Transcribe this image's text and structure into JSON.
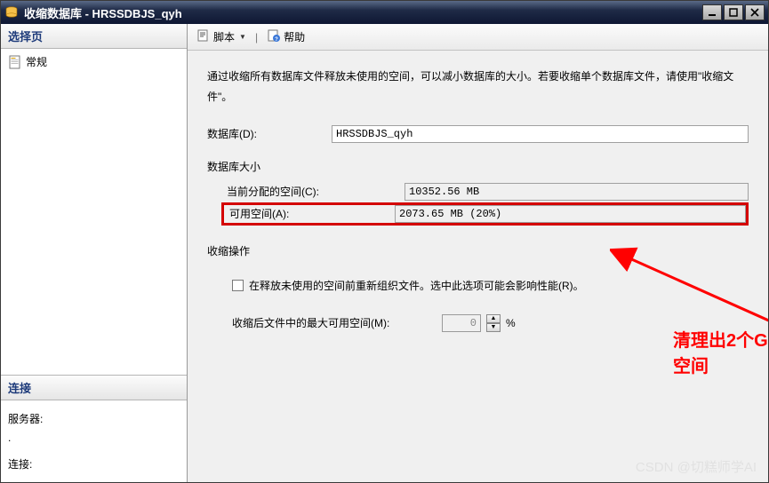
{
  "window": {
    "title": "收缩数据库 - HRSSDBJS_qyh"
  },
  "left": {
    "select_header": "选择页",
    "tree_item": "常规",
    "connection_header": "连接",
    "server_label": "服务器:",
    "connection_label": "连接:"
  },
  "toolbar": {
    "script": "脚本",
    "help": "帮助"
  },
  "content": {
    "intro": "通过收缩所有数据库文件释放未使用的空间，可以减小数据库的大小。若要收缩单个数据库文件，请使用\"收缩文件\"。",
    "db_label": "数据库(D):",
    "db_value": "HRSSDBJS_qyh",
    "size_section": "数据库大小",
    "allocated_label": "当前分配的空间(C):",
    "allocated_value": "10352.56 MB",
    "free_label": "可用空间(A):",
    "free_value": "2073.65 MB (20%)",
    "shrink_section": "收缩操作",
    "reorganize_label": "在释放未使用的空间前重新组织文件。选中此选项可能会影响性能(R)。",
    "max_free_label": "收缩后文件中的最大可用空间(M):",
    "max_free_value": "0",
    "percent": "%"
  },
  "annotation": {
    "text": "清理出2个G空间"
  },
  "watermark": "CSDN @切糕师学AI"
}
